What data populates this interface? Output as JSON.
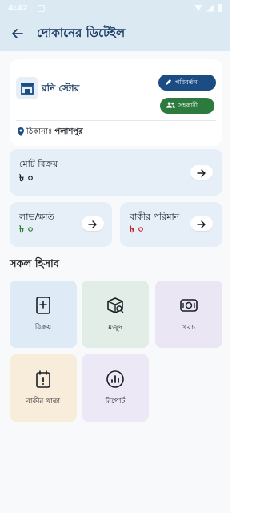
{
  "status_bar": {
    "time": "4:42"
  },
  "app_bar": {
    "title": "দোকানের ডিটেইল"
  },
  "shop": {
    "name": "রনি স্টোর",
    "edit_label": "পরিবর্তন",
    "helper_label": "সহকারী",
    "address_label": "ঠিকানাঃ",
    "address_value": "পলাশপুর"
  },
  "stats": {
    "total_sales": {
      "label": "মোট বিক্রয়",
      "value": "৳ ০"
    },
    "profit_loss": {
      "label": "লাভ/ক্ষতি",
      "value": "৳ ০",
      "color": "#2e7d32"
    },
    "due_amount": {
      "label": "বাকীর পরিমান",
      "value": "৳ ০",
      "color": "#c62828"
    }
  },
  "section": {
    "title": "সকল হিসাব"
  },
  "tiles": [
    {
      "label": "বিক্রয়",
      "icon": "sales-receipt-icon",
      "bg": "#deebf7"
    },
    {
      "label": "মজুদ",
      "icon": "stock-box-icon",
      "bg": "#e1ede6"
    },
    {
      "label": "খরচ",
      "icon": "expense-cash-icon",
      "bg": "#ebe6f4"
    },
    {
      "label": "বাকীর খাতা",
      "icon": "due-ledger-icon",
      "bg": "#f8ecdb"
    },
    {
      "label": "রিপোর্ট",
      "icon": "report-chart-icon",
      "bg": "#ece8f6"
    }
  ],
  "colors": {
    "primary": "#1c4c84",
    "accent_green": "#2c7a3e",
    "appbar_bg": "#dbe9f3"
  }
}
